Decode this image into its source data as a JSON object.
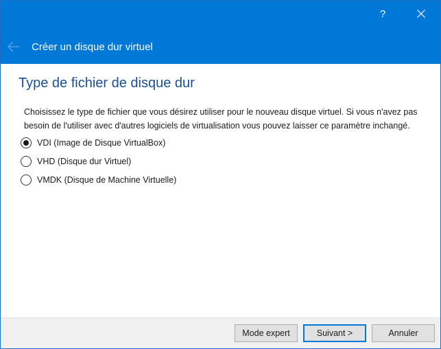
{
  "titlebar": {
    "help_label": "?",
    "close_icon": "close-icon",
    "back_icon": "back-arrow-icon",
    "wizard_title": "Créer un disque dur virtuel"
  },
  "page": {
    "title": "Type de fichier de disque dur",
    "description": "Choisissez le type de fichier que vous désirez utiliser pour le nouveau disque virtuel. Si vous n'avez pas besoin de l'utiliser avec d'autres logiciels de virtualisation vous pouvez laisser ce paramètre inchangé.",
    "options": [
      {
        "label": "VDI (Image de Disque VirtualBox)",
        "checked": true
      },
      {
        "label": "VHD (Disque dur Virtuel)",
        "checked": false
      },
      {
        "label": "VMDK (Disque de Machine Virtuelle)",
        "checked": false
      }
    ]
  },
  "footer": {
    "expert_label": "Mode expert",
    "next_label": "Suivant >",
    "cancel_label": "Annuler"
  },
  "colors": {
    "titlebar": "#0078d7",
    "heading": "#1a4f96",
    "footer": "#f0f0f0"
  }
}
